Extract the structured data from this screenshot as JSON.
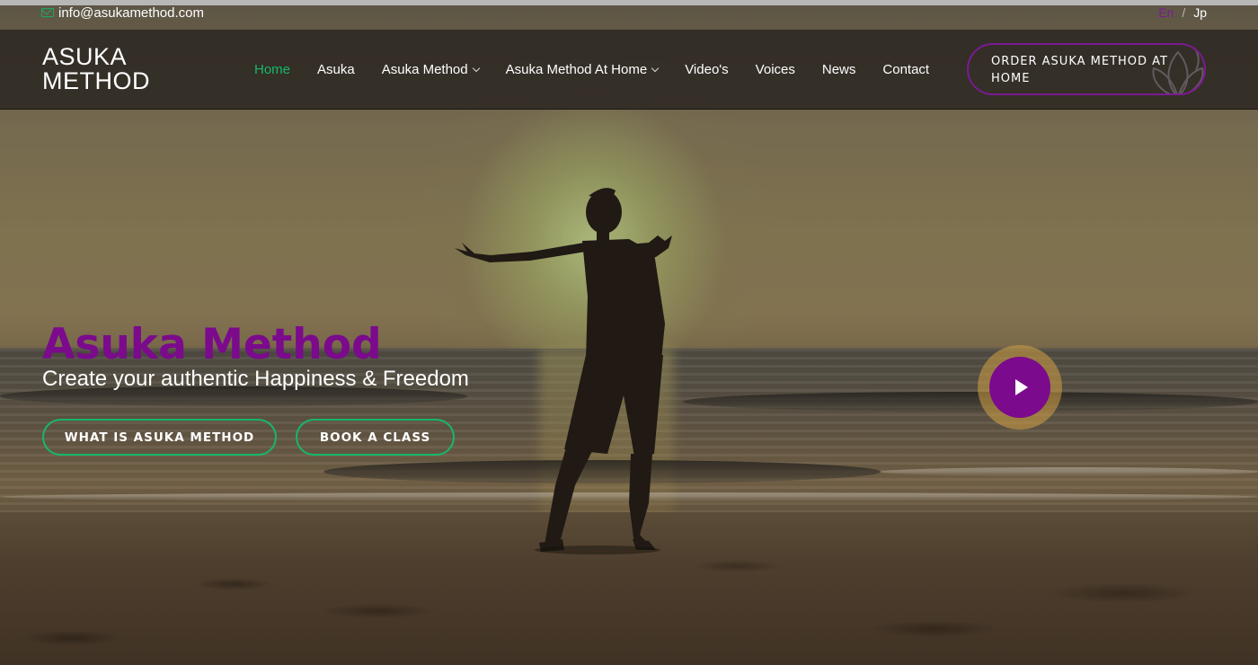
{
  "topbar": {
    "email": "info@asukamethod.com",
    "lang_en": "En",
    "lang_sep": "/",
    "lang_jp": "Jp"
  },
  "logo": {
    "line1": "ASUKA",
    "line2": "METHOD"
  },
  "nav": {
    "items": [
      {
        "label": "Home",
        "active": true
      },
      {
        "label": "Asuka",
        "active": false
      },
      {
        "label": "Asuka Method",
        "active": false,
        "has_dropdown": true
      },
      {
        "label": "Asuka Method At Home",
        "active": false,
        "has_dropdown": true
      },
      {
        "label": "Video's",
        "active": false
      },
      {
        "label": "Voices",
        "active": false
      },
      {
        "label": "News",
        "active": false
      },
      {
        "label": "Contact",
        "active": false
      }
    ],
    "order_button": "ORDER ASUKA METHOD AT HOME"
  },
  "hero": {
    "title": "Asuka Method",
    "subtitle": "Create your authentic Happiness & Freedom",
    "cta_primary": "WHAT IS ASUKA METHOD",
    "cta_secondary": "BOOK A CLASS"
  },
  "icons": {
    "email": "mail-icon",
    "dropdown": "chevron-down-icon",
    "play": "play-icon",
    "order_decoration": "lotus-icon"
  },
  "colors": {
    "accent_purple": "#7b0a8c",
    "accent_green": "#16b86a",
    "nav_background": "#2c2822"
  }
}
